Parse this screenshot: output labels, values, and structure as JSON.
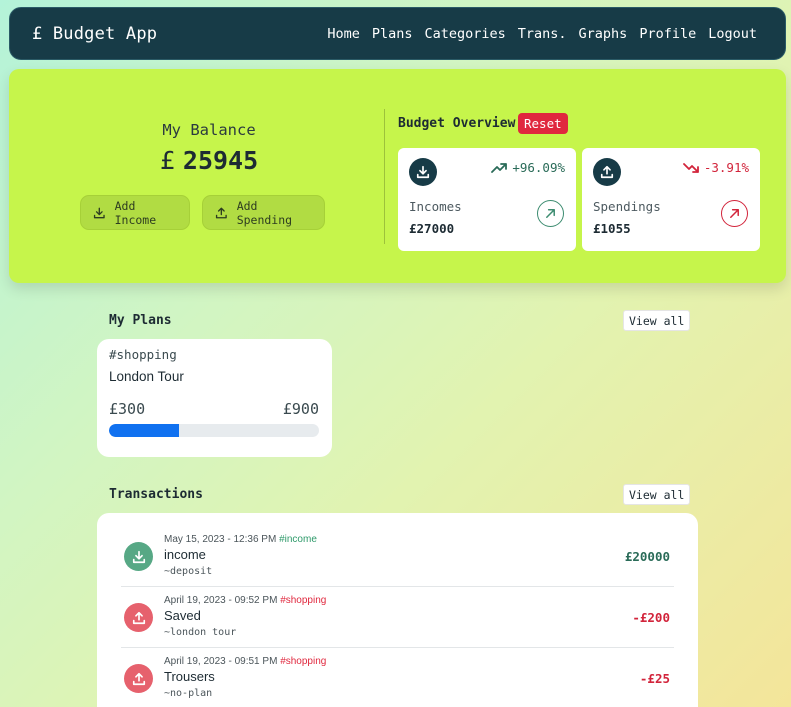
{
  "nav": {
    "brand": "£ Budget App",
    "links": [
      "Home",
      "Plans",
      "Categories",
      "Trans.",
      "Graphs",
      "Profile",
      "Logout"
    ]
  },
  "balance": {
    "title": "My Balance",
    "currency": "£",
    "amount": "25945",
    "add_income_label": "Add Income",
    "add_spending_label": "Add Spending"
  },
  "overview": {
    "title": "Budget Overview",
    "reset_label": "Reset",
    "income": {
      "label": "Incomes",
      "value": "£27000",
      "change": "+96.09%"
    },
    "spending": {
      "label": "Spendings",
      "value": "£1055",
      "change": "-3.91%"
    }
  },
  "plans": {
    "title": "My Plans",
    "view_all_label": "View all",
    "items": [
      {
        "tag": "#shopping",
        "name": "London Tour",
        "saved": "£300",
        "target": "£900",
        "progress": 0.333
      }
    ]
  },
  "transactions": {
    "title": "Transactions",
    "view_all_label": "View all",
    "items": [
      {
        "date": "May 15, 2023 - 12:36 PM",
        "category": "#income",
        "title": "income",
        "plan": "~deposit",
        "amount": "£20000",
        "type": "income"
      },
      {
        "date": "April 19, 2023 - 09:52 PM",
        "category": "#shopping",
        "title": "Saved",
        "plan": "~london tour",
        "amount": "-£200",
        "type": "spending"
      },
      {
        "date": "April 19, 2023 - 09:51 PM",
        "category": "#shopping",
        "title": "Trousers",
        "plan": "~no-plan",
        "amount": "-£25",
        "type": "spending"
      }
    ]
  },
  "colors": {
    "navbar": "#173b47",
    "hero": "#c6f54b",
    "income_accent": "#2a6b58",
    "spending_accent": "#d2243b",
    "reset": "#e0283e",
    "progress": "#1071f0"
  }
}
